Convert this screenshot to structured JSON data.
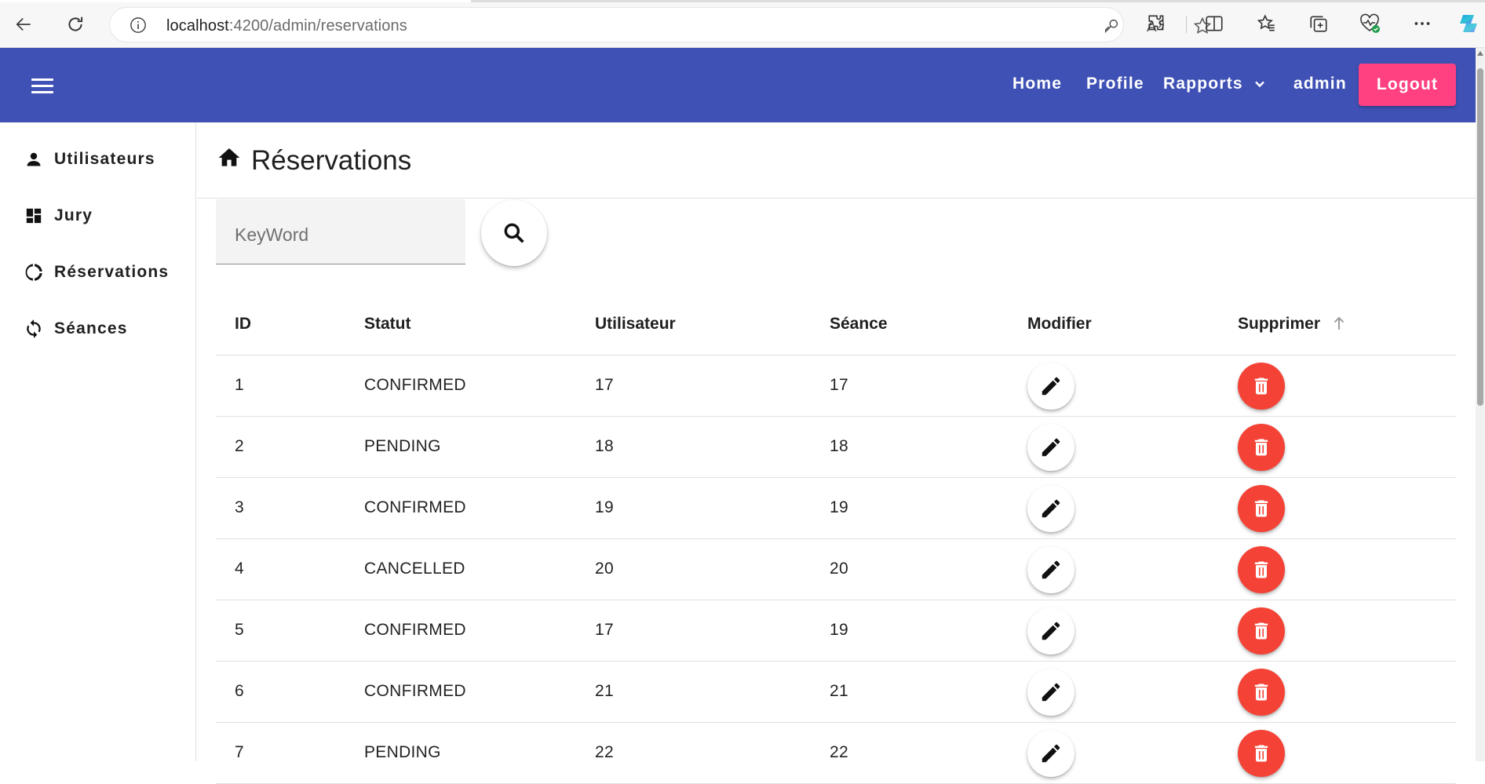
{
  "browser": {
    "url_host": "localhost",
    "url_path": ":4200/admin/reservations"
  },
  "header": {
    "nav": [
      "Home",
      "Profile",
      "Rapports",
      "admin"
    ],
    "logout_label": "Logout",
    "bg_color": "#3f51b5",
    "logout_color": "#ff4081"
  },
  "sidebar": {
    "items": [
      {
        "label": "Utilisateurs",
        "icon": "person-icon"
      },
      {
        "label": "Jury",
        "icon": "dashboard-icon"
      },
      {
        "label": "Réservations",
        "icon": "donut-icon"
      },
      {
        "label": "Séances",
        "icon": "sync-icon"
      }
    ]
  },
  "main": {
    "title": "Réservations",
    "search_placeholder": "KeyWord",
    "columns": [
      "ID",
      "Statut",
      "Utilisateur",
      "Séance",
      "Modifier",
      "Supprimer"
    ],
    "rows": [
      {
        "id": "1",
        "statut": "CONFIRMED",
        "utilisateur": "17",
        "seance": "17"
      },
      {
        "id": "2",
        "statut": "PENDING",
        "utilisateur": "18",
        "seance": "18"
      },
      {
        "id": "3",
        "statut": "CONFIRMED",
        "utilisateur": "19",
        "seance": "19"
      },
      {
        "id": "4",
        "statut": "CANCELLED",
        "utilisateur": "20",
        "seance": "20"
      },
      {
        "id": "5",
        "statut": "CONFIRMED",
        "utilisateur": "17",
        "seance": "19"
      },
      {
        "id": "6",
        "statut": "CONFIRMED",
        "utilisateur": "21",
        "seance": "21"
      },
      {
        "id": "7",
        "statut": "PENDING",
        "utilisateur": "22",
        "seance": "22"
      }
    ],
    "delete_color": "#f44336"
  }
}
